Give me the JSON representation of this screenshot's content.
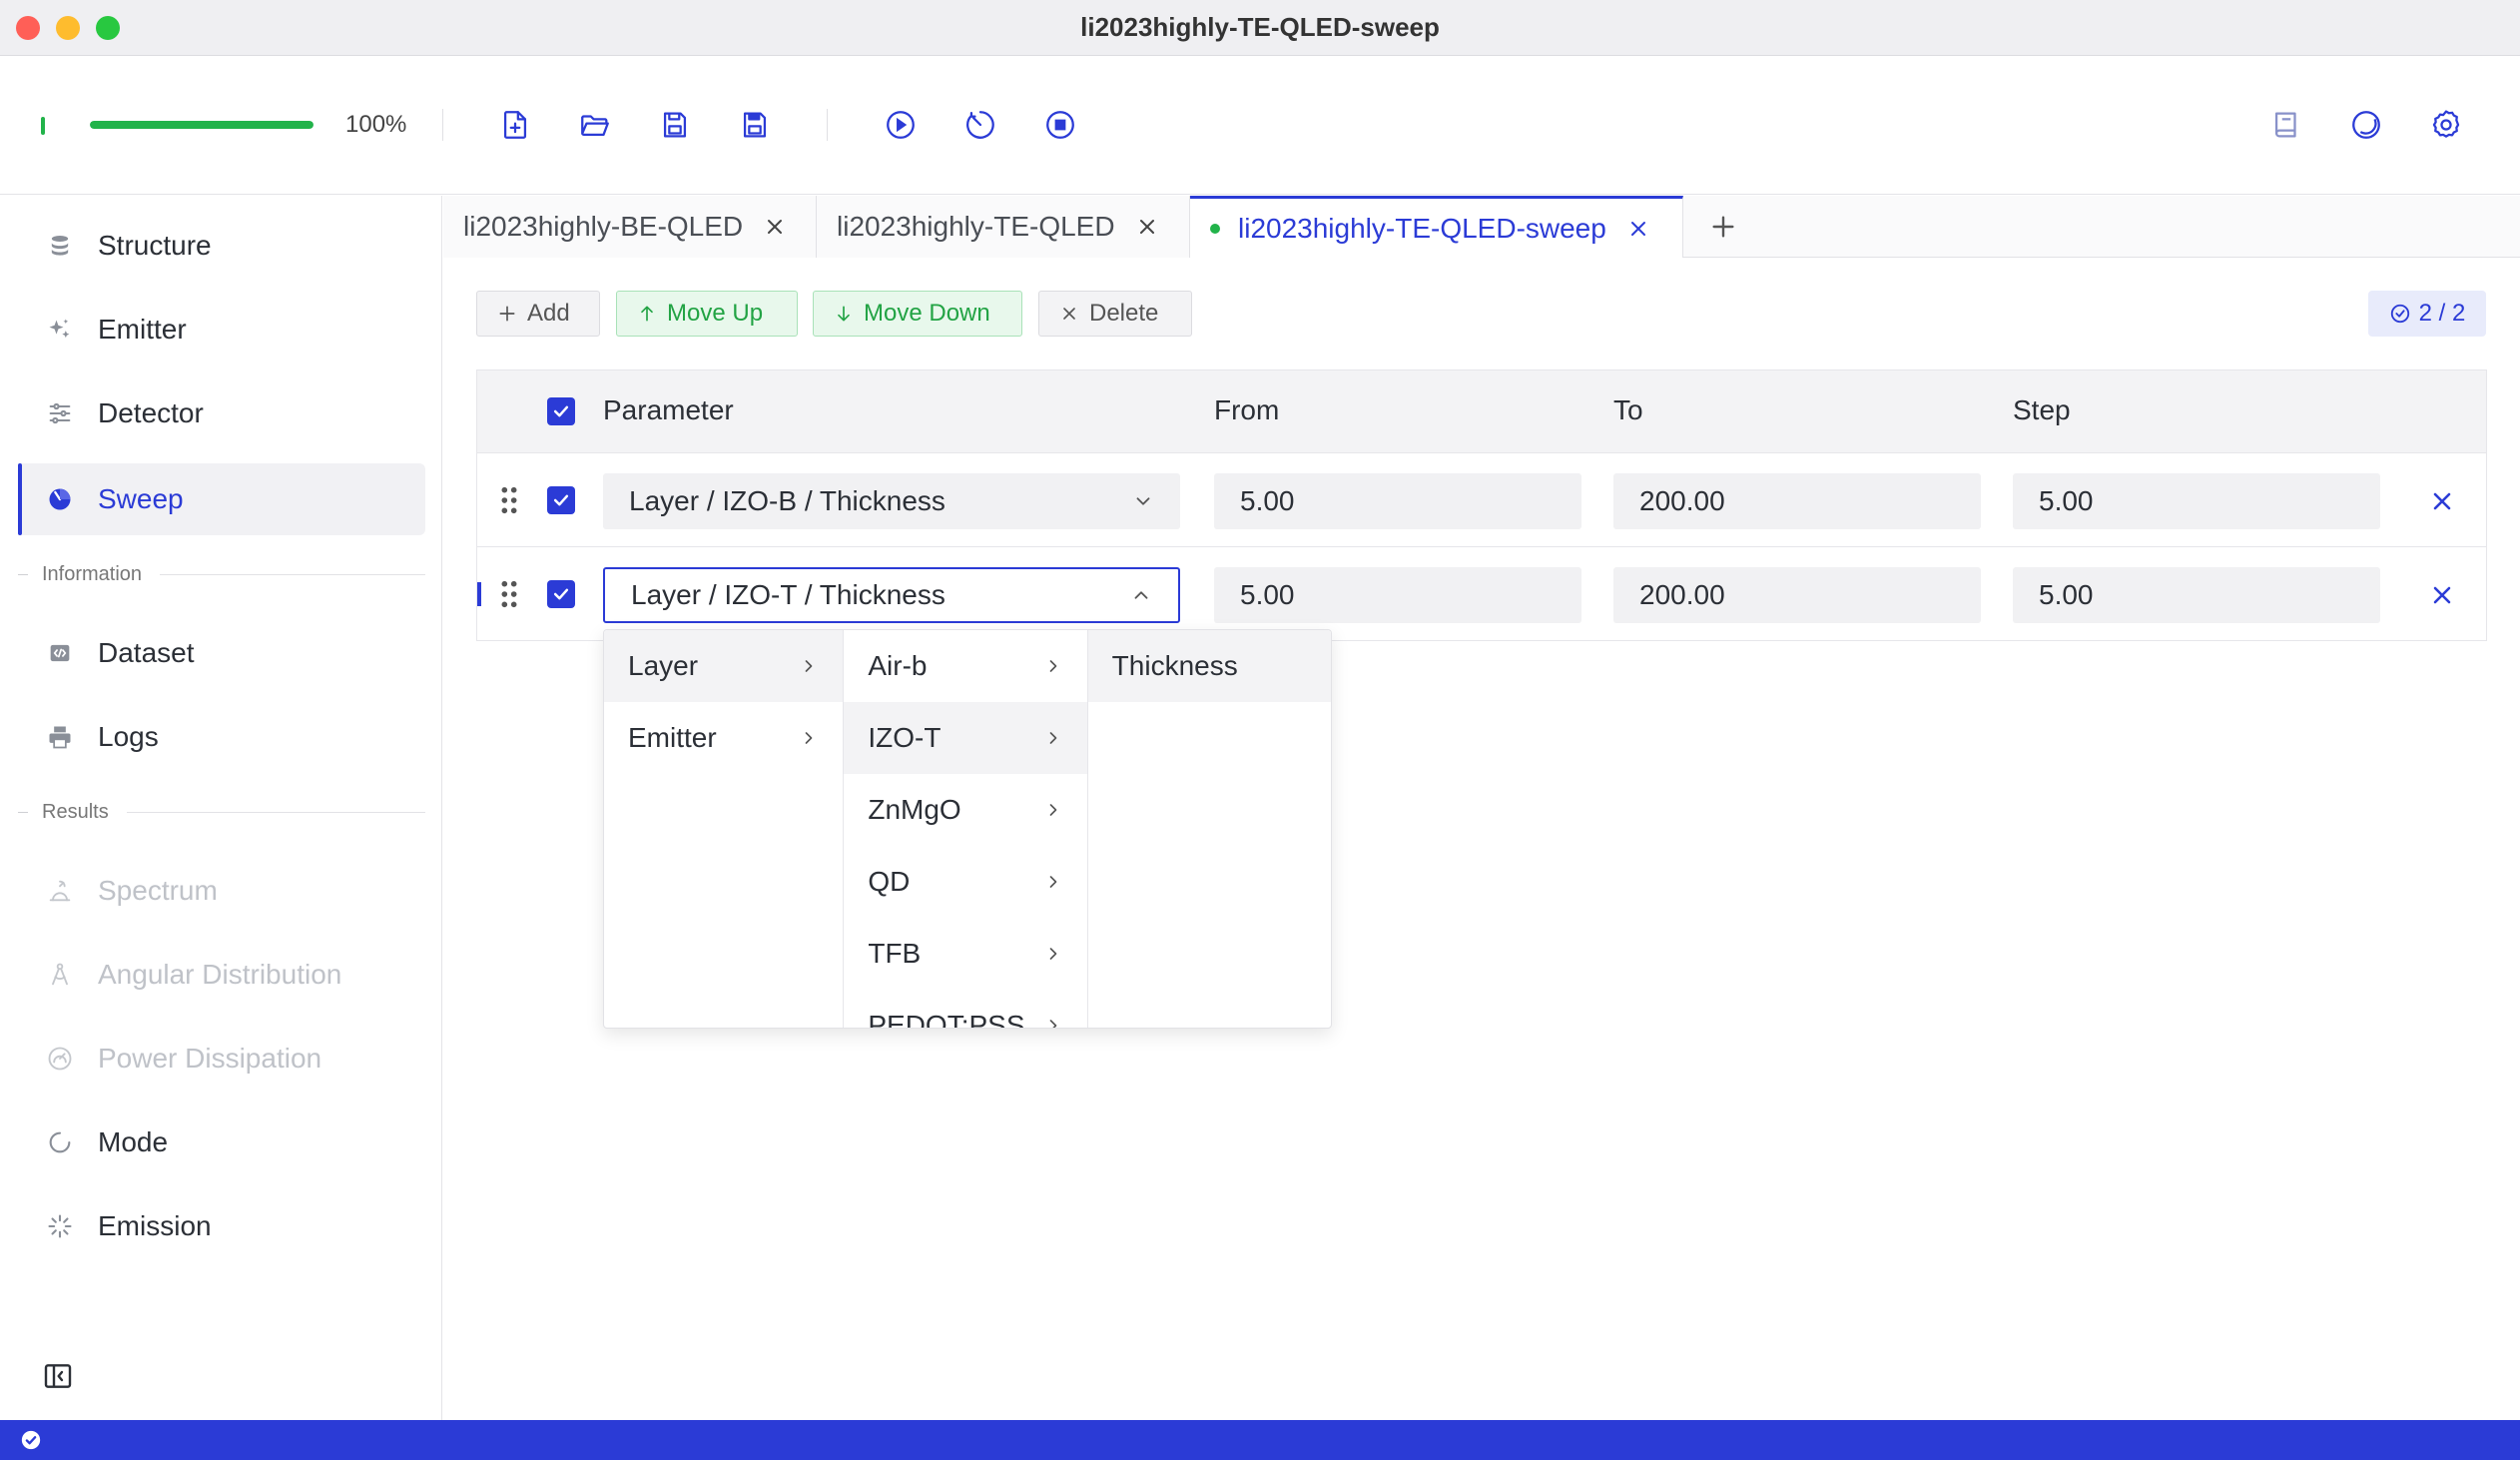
{
  "window": {
    "title": "li2023highly-TE-QLED-sweep"
  },
  "toolbar": {
    "progress_percent": 100,
    "progress_label": "100%",
    "icons": [
      "new-file-icon",
      "open-folder-icon",
      "save-icon",
      "save-as-icon",
      "run-icon",
      "timer-icon",
      "stop-icon",
      "book-icon",
      "theme-icon",
      "gear-icon"
    ]
  },
  "sidebar": {
    "items": [
      {
        "label": "Structure",
        "icon": "layers-icon",
        "state": "normal"
      },
      {
        "label": "Emitter",
        "icon": "sparkle-icon",
        "state": "normal"
      },
      {
        "label": "Detector",
        "icon": "sliders-icon",
        "state": "normal"
      },
      {
        "label": "Sweep",
        "icon": "sweep-icon",
        "state": "active"
      }
    ],
    "section_information": "Information",
    "info_items": [
      {
        "label": "Dataset",
        "icon": "code-file-icon",
        "state": "normal"
      },
      {
        "label": "Logs",
        "icon": "printer-icon",
        "state": "normal"
      }
    ],
    "section_results": "Results",
    "result_items": [
      {
        "label": "Spectrum",
        "icon": "spectrum-icon",
        "state": "disabled"
      },
      {
        "label": "Angular Distribution",
        "icon": "angle-icon",
        "state": "disabled"
      },
      {
        "label": "Power Dissipation",
        "icon": "gauge-icon",
        "state": "disabled"
      },
      {
        "label": "Mode",
        "icon": "circle-icon",
        "state": "normal"
      },
      {
        "label": "Emission",
        "icon": "burst-icon",
        "state": "normal"
      }
    ]
  },
  "tabs": [
    {
      "label": "li2023highly-BE-QLED",
      "active": false
    },
    {
      "label": "li2023highly-TE-QLED",
      "active": false
    },
    {
      "label": "li2023highly-TE-QLED-sweep",
      "active": true
    }
  ],
  "actions": {
    "add": "Add",
    "move_up": "Move Up",
    "move_down": "Move Down",
    "delete": "Delete",
    "count": "2 / 2"
  },
  "table": {
    "headers": {
      "parameter": "Parameter",
      "from": "From",
      "to": "To",
      "step": "Step"
    },
    "rows": [
      {
        "parameter": "Layer / IZO-B / Thickness",
        "from": "5.00",
        "to": "200.00",
        "step": "5.00",
        "checked": true
      },
      {
        "parameter": "Layer / IZO-T / Thickness",
        "from": "5.00",
        "to": "200.00",
        "step": "5.00",
        "checked": true
      }
    ]
  },
  "cascade": {
    "col1": [
      "Layer",
      "Emitter"
    ],
    "col2": [
      "Air-b",
      "IZO-T",
      "ZnMgO",
      "QD",
      "TFB",
      "PEDOT:PSS"
    ],
    "col3": [
      "Thickness"
    ]
  },
  "colors": {
    "accent": "#2b3bd6",
    "success": "#22b34a"
  }
}
